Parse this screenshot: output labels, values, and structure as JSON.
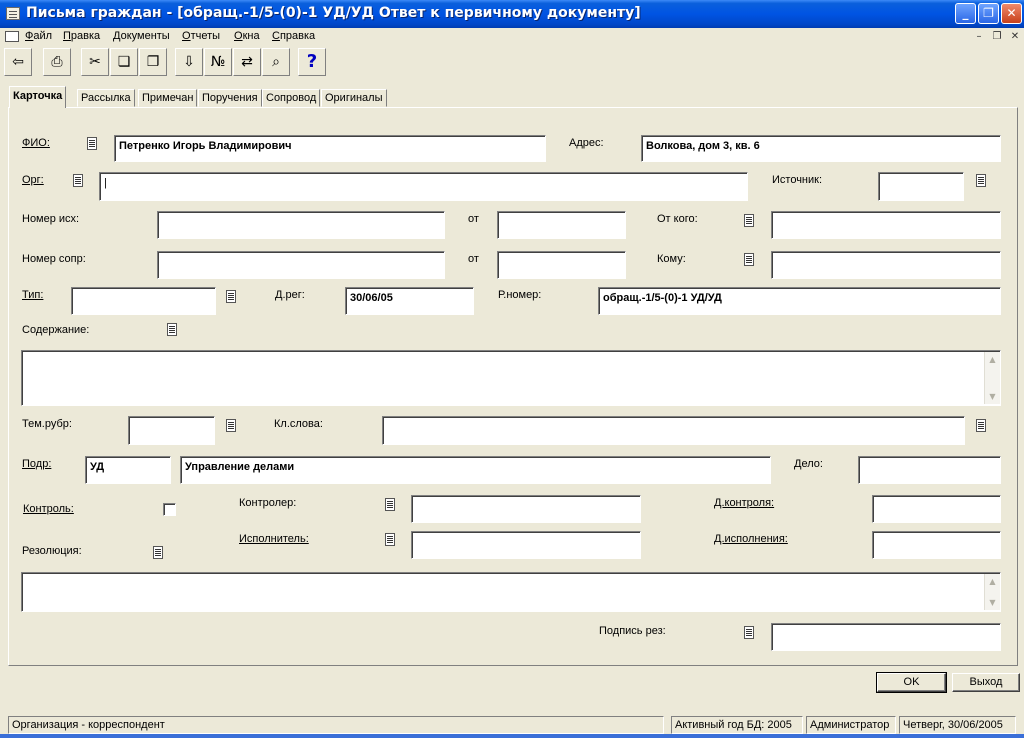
{
  "window": {
    "title": "Письма граждан - [обращ.-1/5-(0)-1 УД/УД Ответ к первичному документу]",
    "minimize_glyph": "_",
    "restore_glyph": "❐",
    "close_glyph": "✕"
  },
  "menu": {
    "items": [
      "Файл",
      "Правка",
      "Документы",
      "Отчеты",
      "Окна",
      "Справка"
    ],
    "mdi_minimize": "–",
    "mdi_restore": "❐",
    "mdi_close": "✕"
  },
  "toolbar": {
    "icons": [
      "exit-door-icon",
      "printer-icon",
      "cut-icon",
      "copy-icon",
      "paste-icon",
      "scan-icon",
      "numbering-icon",
      "route-icon",
      "binoculars-icon",
      "help-icon"
    ],
    "glyphs": [
      "⇦",
      "⎙",
      "✂",
      "❏",
      "❐",
      "⇩",
      "№",
      "⇄",
      "⌕",
      "?"
    ]
  },
  "tabs": [
    "Карточка",
    "Рассылка",
    "Примечан",
    "Поручения",
    "Сопровод",
    "Оригиналы"
  ],
  "form": {
    "fio_label": "ФИО:",
    "fio_value": "Петренко Игорь Владимирович",
    "address_label": "Адрес:",
    "address_value": "Волкова, дом 3, кв. 6",
    "org_label": "Орг:",
    "org_value": "|",
    "source_label": "Источник:",
    "source_value": "",
    "out_number_label": "Номер исх:",
    "out_number_value": "",
    "from_label": "от",
    "out_date_value": "",
    "from_whom_label": "От кого:",
    "from_whom_value": "",
    "cover_number_label": "Номер сопр:",
    "cover_number_value": "",
    "cover_from_label": "от",
    "cover_date_value": "",
    "to_whom_label": "Кому:",
    "to_whom_value": "",
    "type_label": "Тип:",
    "type_value": "",
    "reg_date_label": "Д.рег:",
    "reg_date_value": "30/06/05",
    "reg_number_label": "Р.номер:",
    "reg_number_value": "обращ.-1/5-(0)-1 УД/УД",
    "content_label": "Содержание:",
    "content_value": "",
    "rubric_label": "Тем.рубр:",
    "rubric_value": "",
    "keywords_label": "Кл.слова:",
    "keywords_value": "",
    "division_label": "Подр:",
    "division_code": "УД",
    "division_name": "Управление делами",
    "case_label": "Дело:",
    "case_value": "",
    "control_label": "Контроль:",
    "controller_label": "Контролер:",
    "controller_value": "",
    "control_date_label": "Д.контроля:",
    "control_date_value": "",
    "resolution_label": "Резолюция:",
    "resolution_value": "",
    "executor_label": "Исполнитель:",
    "executor_value": "",
    "exec_date_label": "Д.исполнения:",
    "exec_date_value": "",
    "signature_label": "Подпись рез:",
    "signature_value": ""
  },
  "scroll_up": "▲",
  "scroll_down": "▼",
  "buttons": {
    "ok": "OK",
    "exit": "Выход"
  },
  "status": {
    "left": "Организация - корреспондент",
    "year": "Активный год БД: 2005",
    "user": "Администратор",
    "date": "Четверг, 30/06/2005"
  }
}
